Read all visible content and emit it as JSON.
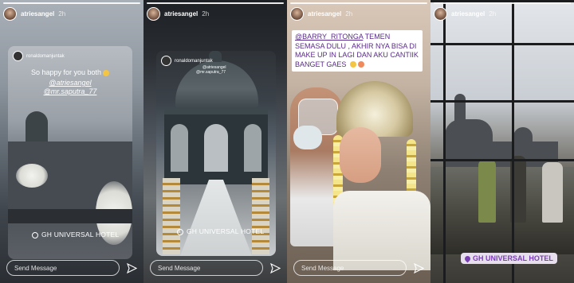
{
  "stories": [
    {
      "username": "atriesangel",
      "time": "2h",
      "shared_from": "ronaldomanjuntak",
      "card_mentions": [
        "",
        ""
      ],
      "caption": "So happy for you both",
      "tags": [
        "@atriesangel",
        "@mr.saputra_77"
      ],
      "location": "GH UNIVERSAL HOTEL",
      "message_placeholder": "Send Message"
    },
    {
      "username": "atriesangel",
      "time": "2h",
      "shared_from": "ronaldomanjuntak",
      "card_mentions": [
        "@atriesangel",
        "@mr.saputra_77"
      ],
      "location": "GH UNIVERSAL HOTEL",
      "message_placeholder": "Send Message"
    },
    {
      "username": "atriesangel",
      "time": "2h",
      "text_tag": "@BARRY_RITONGA",
      "text_body": "TEMEN SEMASA DULU , AKHIR NYA BISA DI MAKE UP IN LAGI DAN AKU CANTIIK BANGET GAES",
      "message_placeholder": "Send Message"
    },
    {
      "username": "atriesangel",
      "time": "2h",
      "location": "GH UNIVERSAL HOTEL",
      "message_placeholder": "Send Message"
    }
  ],
  "icons": {
    "send": "send-arrow-icon",
    "location": "location-pin-icon",
    "emoji": "smiling-face-emoji"
  },
  "colors": {
    "text_purple": "#5a2a8c",
    "location_sticker": "#7b3fb4",
    "chair_ribbon": "#b48a3a"
  }
}
